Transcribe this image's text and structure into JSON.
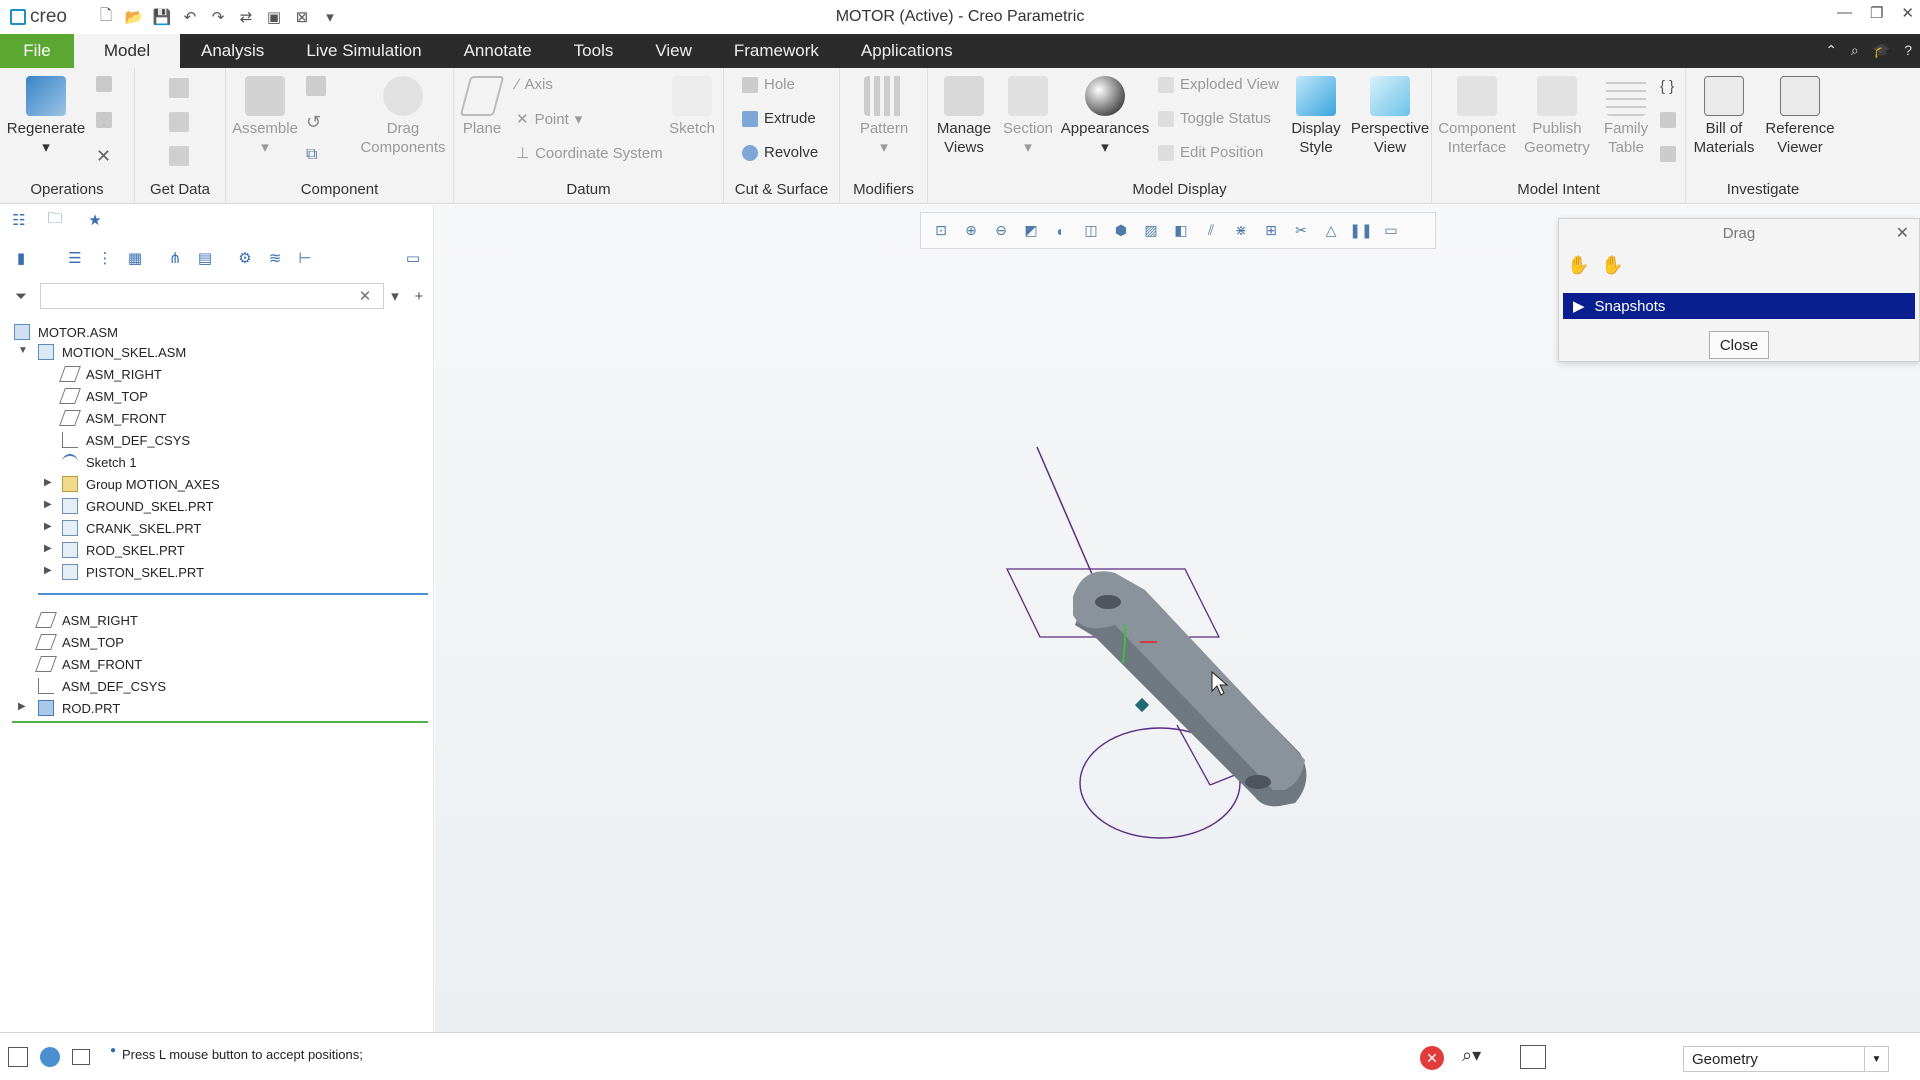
{
  "app": {
    "logo": "creo",
    "window_title": "MOTOR (Active) - Creo Parametric"
  },
  "tabs": [
    "File",
    "Model",
    "Analysis",
    "Live Simulation",
    "Annotate",
    "Tools",
    "View",
    "Framework",
    "Applications"
  ],
  "ribbon": {
    "operations": {
      "regenerate": "Regenerate",
      "group": "Operations"
    },
    "get_data": {
      "group": "Get Data"
    },
    "component": {
      "assemble": "Assemble",
      "drag_components": "Drag Components",
      "group": "Component"
    },
    "datum": {
      "plane": "Plane",
      "axis": "Axis",
      "point": "Point",
      "csys": "Coordinate System",
      "sketch": "Sketch",
      "group": "Datum"
    },
    "cut_surface": {
      "hole": "Hole",
      "extrude": "Extrude",
      "revolve": "Revolve",
      "group": "Cut & Surface"
    },
    "modifiers": {
      "pattern": "Pattern",
      "group": "Modifiers"
    },
    "model_display": {
      "manage_views": "Manage Views",
      "section": "Section",
      "appearances": "Appearances",
      "exploded_view": "Exploded View",
      "toggle_status": "Toggle Status",
      "edit_position": "Edit Position",
      "display_style": "Display Style",
      "perspective_view": "Perspective View",
      "group": "Model Display"
    },
    "model_intent": {
      "component_interface": "Component Interface",
      "publish_geometry": "Publish Geometry",
      "family_table": "Family Table",
      "group": "Model Intent"
    },
    "investigate": {
      "bom": "Bill of Materials",
      "reference_viewer": "Reference Viewer",
      "group": "Investigate"
    }
  },
  "tree": {
    "root": "MOTOR.ASM",
    "skel": "MOTION_SKEL.ASM",
    "skel_items": [
      "ASM_RIGHT",
      "ASM_TOP",
      "ASM_FRONT",
      "ASM_DEF_CSYS",
      "Sketch 1",
      "Group MOTION_AXES",
      "GROUND_SKEL.PRT",
      "CRANK_SKEL.PRT",
      "ROD_SKEL.PRT",
      "PISTON_SKEL.PRT"
    ],
    "asm_items": [
      "ASM_RIGHT",
      "ASM_TOP",
      "ASM_FRONT",
      "ASM_DEF_CSYS",
      "ROD.PRT"
    ]
  },
  "drag_dialog": {
    "title": "Drag",
    "snapshots": "Snapshots",
    "close": "Close"
  },
  "status": {
    "message": "Press L mouse button to accept positions;",
    "filter": "Geometry"
  },
  "colors": {
    "file_tab": "#5aa832",
    "tab_bar": "#2b2b2b",
    "snapshots_bg": "#0a1f8f",
    "sketch_lines": "#5a2d82"
  }
}
